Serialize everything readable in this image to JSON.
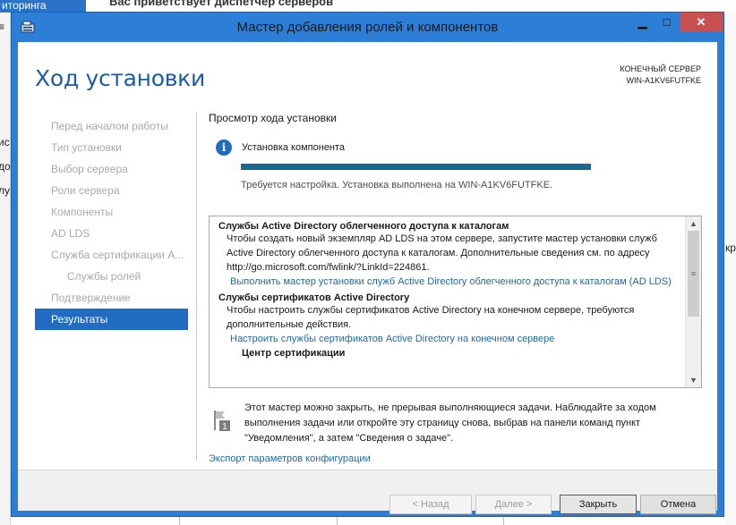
{
  "background": {
    "tab_label": "иторинга",
    "header_text": "Вас приветствует диспетчер серверов",
    "left_fragments": [
      "ис",
      "до",
      "лу"
    ],
    "right_fragment": "кр"
  },
  "window": {
    "title": "Мастер добавления ролей и компонентов",
    "minimize_glyph": "▁",
    "maximize_glyph": "□",
    "close_glyph": "✕"
  },
  "page": {
    "title": "Ход установки",
    "server_caption": "КОНЕЧНЫЙ СЕРВЕР",
    "server_name": "WIN-A1KV6FUTFKE"
  },
  "nav": {
    "items": [
      {
        "label": "Перед началом работы"
      },
      {
        "label": "Тип установки"
      },
      {
        "label": "Выбор сервера"
      },
      {
        "label": "Роли сервера"
      },
      {
        "label": "Компоненты"
      },
      {
        "label": "AD LDS"
      },
      {
        "label": "Служба сертификации А..."
      },
      {
        "label": "Службы ролей"
      },
      {
        "label": "Подтверждение"
      },
      {
        "label": "Результаты"
      }
    ]
  },
  "content": {
    "section_title": "Просмотр хода установки",
    "status": "Установка компонента",
    "progress": 100,
    "progress_note": "Требуется настройка. Установка выполнена на WIN-A1KV6FUTFKE.",
    "results": {
      "ad_lds_head": "Службы Active Directory облегченного доступа к каталогам",
      "ad_lds_text": "Чтобы создать новый экземпляр AD LDS на этом сервере, запустите мастер установки служб Active Directory облегченного доступа к каталогам. Дополнительные сведения см. по адресу http://go.microsoft.com/fwlink/?LinkId=224861.",
      "ad_lds_link": "Выполнить мастер установки служб Active Directory облегченного доступа к каталогам (AD LDS)",
      "adcs_head": "Службы сертификатов Active Directory",
      "adcs_text": "Чтобы настроить службы сертификатов Active Directory на конечном сервере, требуются дополнительные действия.",
      "adcs_link": "Настроить службы сертификатов Active Directory на конечном сервере",
      "ca_sub": "Центр сертификации"
    },
    "note": "Этот мастер можно закрыть, не прерывая выполняющиеся задачи. Наблюдайте за ходом выполнения задачи или откройте эту страницу снова, выбрав на панели команд пункт \"Уведомления\", а затем \"Сведения о задаче\".",
    "note_badge": "1",
    "export_link": "Экспорт параметров конфигурации"
  },
  "footer": {
    "back": "< Назад",
    "next": "Далее >",
    "close": "Закрыть",
    "cancel": "Отмена"
  }
}
